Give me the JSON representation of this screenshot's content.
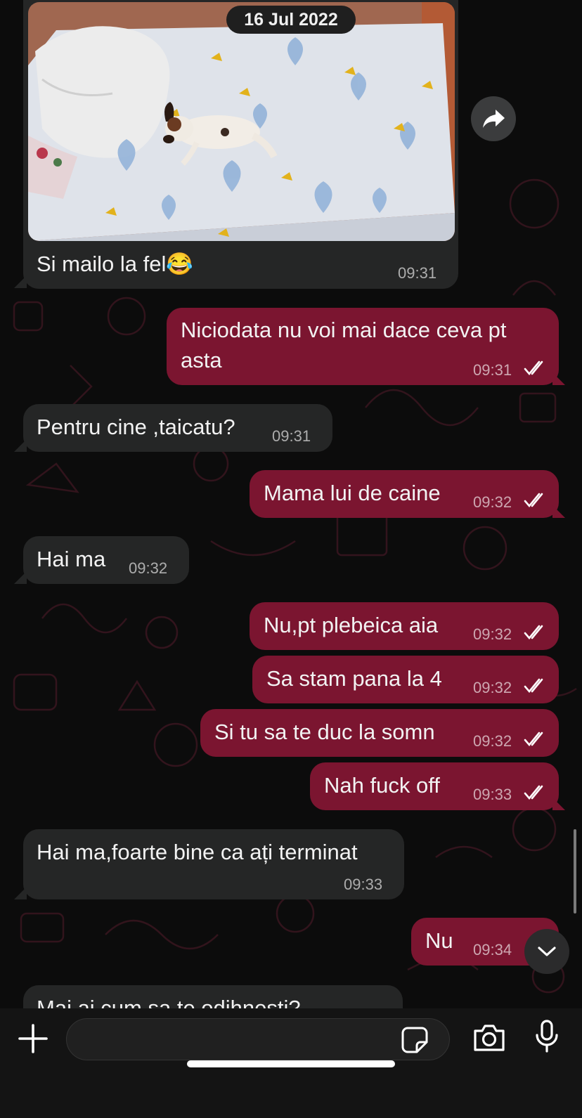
{
  "date_pill": "16 Jul 2022",
  "messages": [
    {
      "text": "Si mailo la fel😂",
      "time": "09:31",
      "dir": "in"
    },
    {
      "line1": "Niciodata nu voi mai dace ceva pt",
      "line2": "asta",
      "time": "09:31",
      "dir": "out"
    },
    {
      "text": "Pentru cine ,taicatu?",
      "time": "09:31",
      "dir": "in"
    },
    {
      "text": "Mama lui de caine",
      "time": "09:32",
      "dir": "out"
    },
    {
      "text": "Hai ma",
      "time": "09:32",
      "dir": "in"
    },
    {
      "text": "Nu,pt plebeica aia",
      "time": "09:32",
      "dir": "out"
    },
    {
      "text": "Sa stam pana la 4",
      "time": "09:32",
      "dir": "out"
    },
    {
      "text": "Si tu sa te duc la somn",
      "time": "09:32",
      "dir": "out"
    },
    {
      "text": "Nah fuck off",
      "time": "09:33",
      "dir": "out"
    },
    {
      "text": "Hai ma,foarte bine ca ați terminat",
      "time": "09:33",
      "dir": "in"
    },
    {
      "text": "Nu",
      "time": "09:34",
      "dir": "out"
    },
    {
      "text": "Mai ai cum sa te odihnesti?",
      "dir": "in"
    }
  ],
  "composer": {
    "placeholder": "",
    "icons": [
      "plus-icon",
      "sticker-icon",
      "camera-icon",
      "microphone-icon"
    ]
  },
  "colors": {
    "incoming_bubble": "#252626",
    "outgoing_bubble": "#7b1530",
    "background": "#0c0c0c"
  }
}
